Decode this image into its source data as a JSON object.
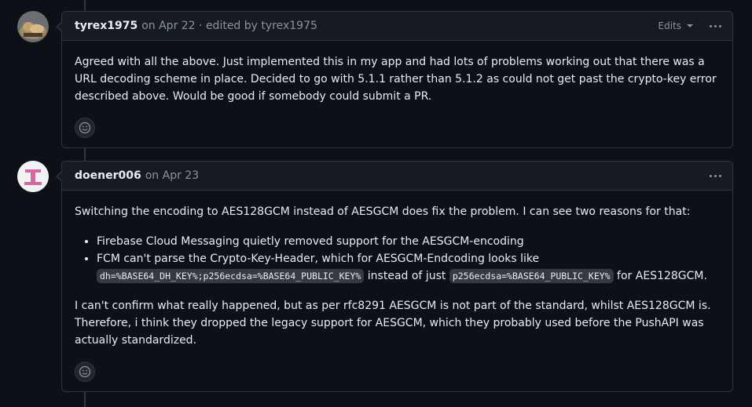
{
  "comments": [
    {
      "author": "tyrex1975",
      "meta": "on Apr 22 · edited by tyrex1975",
      "edits_label": "Edits",
      "body": "Agreed with all the above. Just implemented this in my app and had lots of problems working out that there was a URL decoding scheme in place. Decided to go with 5.1.1 rather than 5.1.2 as could not get past the crypto-key error described above. Would be good if somebody could submit a PR."
    },
    {
      "author": "doener006",
      "meta": "on Apr 23",
      "intro": "Switching the encoding to AES128GCM instead of AESGCM does fix the problem. I can see two reasons for that:",
      "bullet1": "Firebase Cloud Messaging quietly removed support for the AESGCM-encoding",
      "bullet2_pre": "FCM can't parse the Crypto-Key-Header, which for AESGCM-Endcoding looks like",
      "bullet2_code1": "dh=%BASE64_DH_KEY%;p256ecdsa=%BASE64_PUBLIC_KEY%",
      "bullet2_mid": " instead of just ",
      "bullet2_code2": "p256ecdsa=%BASE64_PUBLIC_KEY%",
      "bullet2_post": " for AES128GCM.",
      "outro": "I can't confirm what really happened, but as per rfc8291 AESGCM is not part of the standard, whilst AES128GCM is. Therefore, i think they dropped the legacy support for AESGCM, which they probably used before the PushAPI was actually standardized."
    }
  ],
  "icons": {
    "kebab": "kebab-horizontal-icon",
    "reaction": "smiley-icon"
  },
  "colors": {
    "background": "#0d1117",
    "header": "#161b22",
    "border": "#30363d",
    "muted": "#8b949e"
  }
}
